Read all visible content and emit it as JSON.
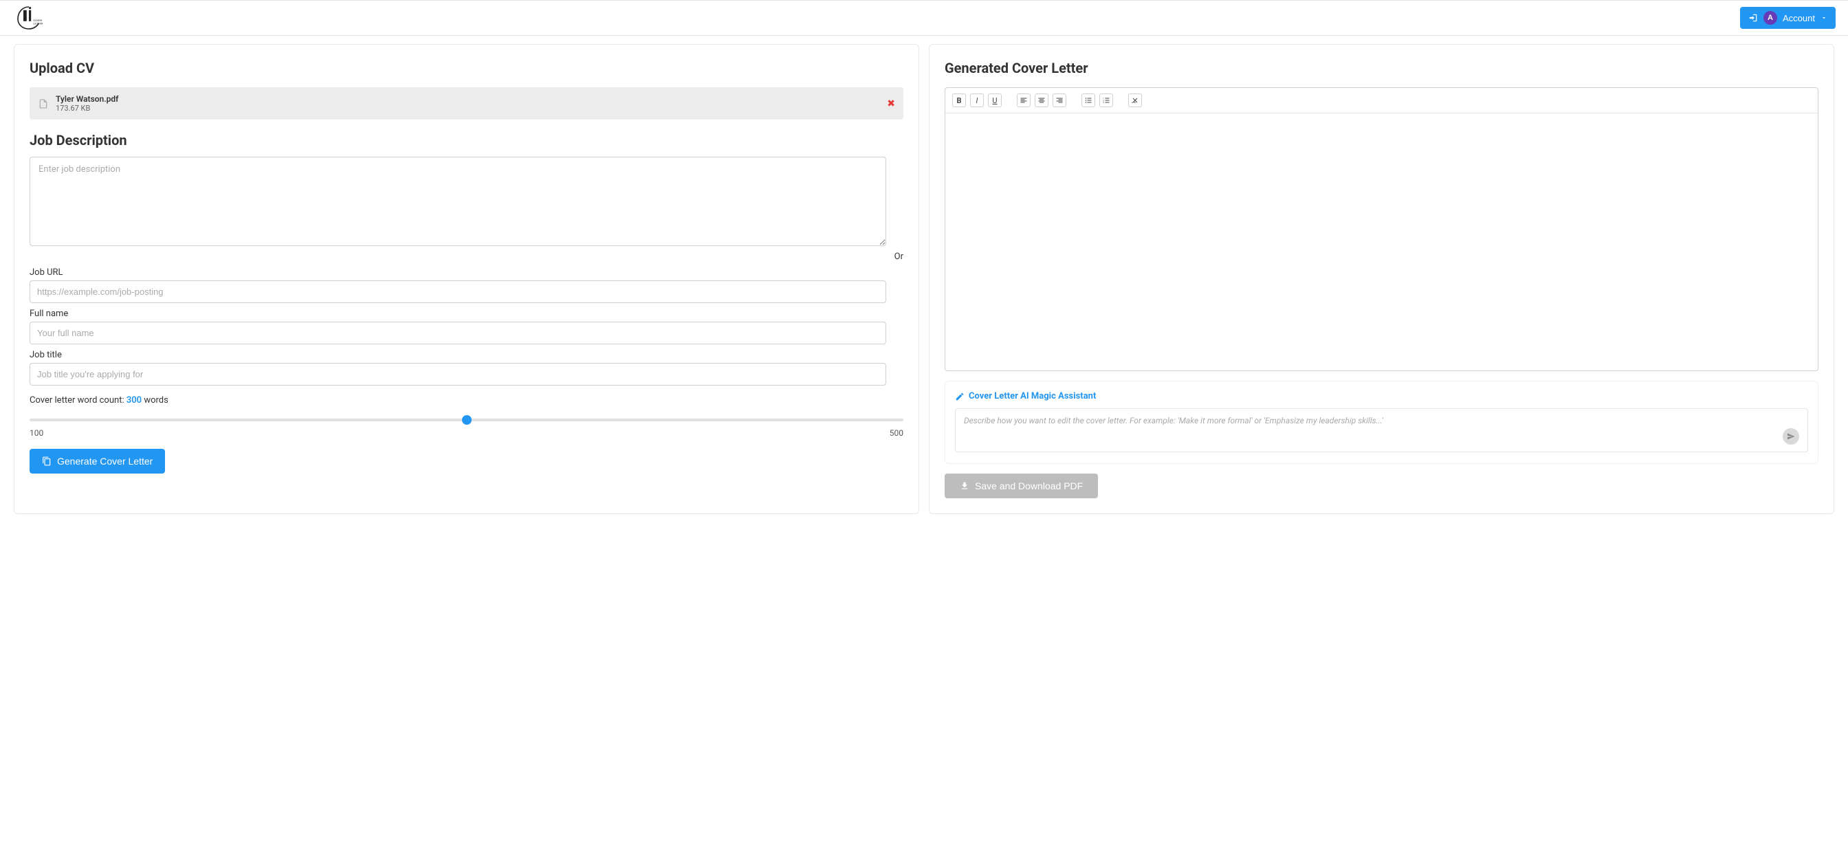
{
  "header": {
    "login_icon": "sign-in",
    "avatar_initial": "A",
    "account_label": "Account"
  },
  "left": {
    "upload_heading": "Upload CV",
    "file": {
      "name": "Tyler Watson.pdf",
      "size": "173.67 KB"
    },
    "job_desc_heading": "Job Description",
    "job_desc_placeholder": "Enter job description",
    "or_text": "Or",
    "job_url_label": "Job URL",
    "job_url_placeholder": "https://example.com/job-posting",
    "full_name_label": "Full name",
    "full_name_placeholder": "Your full name",
    "job_title_label": "Job title",
    "job_title_placeholder": "Job title you're applying for",
    "word_count_prefix": "Cover letter word count: ",
    "word_count_value": "300",
    "word_count_suffix": " words",
    "slider_min_label": "100",
    "slider_max_label": "500",
    "generate_label": "Generate Cover Letter"
  },
  "right": {
    "heading": "Generated Cover Letter",
    "assistant_title": "Cover Letter AI Magic Assistant",
    "assistant_placeholder": "Describe how you want to edit the cover letter. For example: 'Make it more formal' or 'Emphasize my leadership skills...'",
    "save_label": "Save and Download PDF"
  }
}
